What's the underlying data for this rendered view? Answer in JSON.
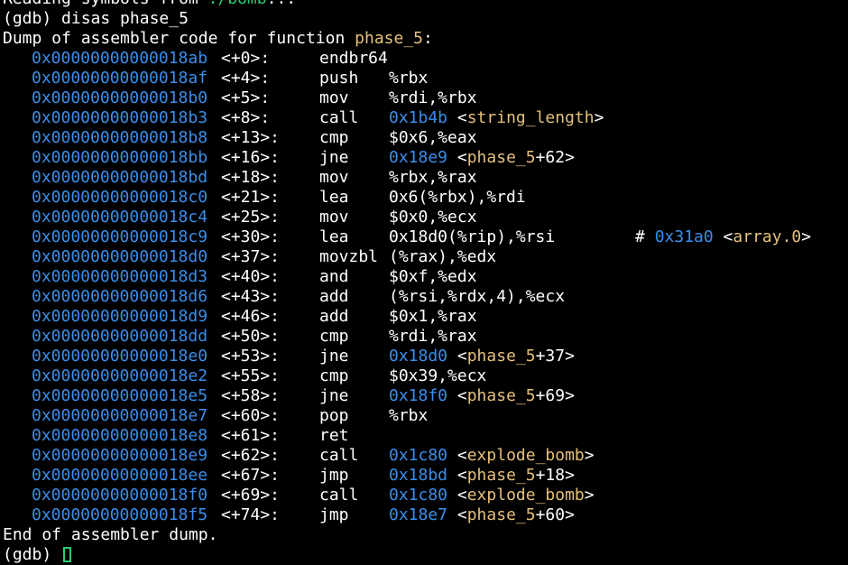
{
  "terminal": {
    "reading_line": {
      "text": "Reading symbols from ",
      "path": "./bomb",
      "suffix": "..."
    },
    "prompt": "(gdb) ",
    "command": "disas phase_5",
    "dump_header": {
      "prefix": "Dump of assembler code for function ",
      "function": "phase_5",
      "suffix": ":"
    },
    "instructions": [
      {
        "addr": "0x00000000000018ab",
        "off": "<+0>:",
        "mn": "endbr64",
        "ops": []
      },
      {
        "addr": "0x00000000000018af",
        "off": "<+4>:",
        "mn": "push",
        "ops": [
          {
            "t": "%rbx",
            "c": "w"
          }
        ]
      },
      {
        "addr": "0x00000000000018b0",
        "off": "<+5>:",
        "mn": "mov",
        "ops": [
          {
            "t": "%rdi,%rbx",
            "c": "w"
          }
        ]
      },
      {
        "addr": "0x00000000000018b3",
        "off": "<+8>:",
        "mn": "call",
        "ops": [
          {
            "t": "0x1b4b",
            "c": "b"
          },
          {
            "t": " <",
            "c": "w"
          },
          {
            "t": "string_length",
            "c": "y"
          },
          {
            "t": ">",
            "c": "w"
          }
        ]
      },
      {
        "addr": "0x00000000000018b8",
        "off": "<+13>:",
        "mn": "cmp",
        "ops": [
          {
            "t": "$0x6,%eax",
            "c": "w"
          }
        ]
      },
      {
        "addr": "0x00000000000018bb",
        "off": "<+16>:",
        "mn": "jne",
        "ops": [
          {
            "t": "0x18e9",
            "c": "b"
          },
          {
            "t": " <",
            "c": "w"
          },
          {
            "t": "phase_5",
            "c": "y"
          },
          {
            "t": "+62>",
            "c": "w"
          }
        ]
      },
      {
        "addr": "0x00000000000018bd",
        "off": "<+18>:",
        "mn": "mov",
        "ops": [
          {
            "t": "%rbx,%rax",
            "c": "w"
          }
        ]
      },
      {
        "addr": "0x00000000000018c0",
        "off": "<+21>:",
        "mn": "lea",
        "ops": [
          {
            "t": "0x6(%rbx),%rdi",
            "c": "w"
          }
        ]
      },
      {
        "addr": "0x00000000000018c4",
        "off": "<+25>:",
        "mn": "mov",
        "ops": [
          {
            "t": "$0x0,%ecx",
            "c": "w"
          }
        ]
      },
      {
        "addr": "0x00000000000018c9",
        "off": "<+30>:",
        "mn": "lea",
        "ops": [
          {
            "t": "0x18d0(%rip),%rsi",
            "c": "w"
          }
        ],
        "comment": [
          {
            "t": "# ",
            "c": "w"
          },
          {
            "t": "0x31a0",
            "c": "b"
          },
          {
            "t": " <",
            "c": "w"
          },
          {
            "t": "array.0",
            "c": "y"
          },
          {
            "t": ">",
            "c": "w"
          }
        ]
      },
      {
        "addr": "0x00000000000018d0",
        "off": "<+37>:",
        "mn": "movzbl",
        "ops": [
          {
            "t": "(%rax),%edx",
            "c": "w"
          }
        ]
      },
      {
        "addr": "0x00000000000018d3",
        "off": "<+40>:",
        "mn": "and",
        "ops": [
          {
            "t": "$0xf,%edx",
            "c": "w"
          }
        ]
      },
      {
        "addr": "0x00000000000018d6",
        "off": "<+43>:",
        "mn": "add",
        "ops": [
          {
            "t": "(%rsi,%rdx,4),%ecx",
            "c": "w"
          }
        ]
      },
      {
        "addr": "0x00000000000018d9",
        "off": "<+46>:",
        "mn": "add",
        "ops": [
          {
            "t": "$0x1,%rax",
            "c": "w"
          }
        ]
      },
      {
        "addr": "0x00000000000018dd",
        "off": "<+50>:",
        "mn": "cmp",
        "ops": [
          {
            "t": "%rdi,%rax",
            "c": "w"
          }
        ]
      },
      {
        "addr": "0x00000000000018e0",
        "off": "<+53>:",
        "mn": "jne",
        "ops": [
          {
            "t": "0x18d0",
            "c": "b"
          },
          {
            "t": " <",
            "c": "w"
          },
          {
            "t": "phase_5",
            "c": "y"
          },
          {
            "t": "+37>",
            "c": "w"
          }
        ]
      },
      {
        "addr": "0x00000000000018e2",
        "off": "<+55>:",
        "mn": "cmp",
        "ops": [
          {
            "t": "$0x39,%ecx",
            "c": "w"
          }
        ]
      },
      {
        "addr": "0x00000000000018e5",
        "off": "<+58>:",
        "mn": "jne",
        "ops": [
          {
            "t": "0x18f0",
            "c": "b"
          },
          {
            "t": " <",
            "c": "w"
          },
          {
            "t": "phase_5",
            "c": "y"
          },
          {
            "t": "+69>",
            "c": "w"
          }
        ]
      },
      {
        "addr": "0x00000000000018e7",
        "off": "<+60>:",
        "mn": "pop",
        "ops": [
          {
            "t": "%rbx",
            "c": "w"
          }
        ]
      },
      {
        "addr": "0x00000000000018e8",
        "off": "<+61>:",
        "mn": "ret",
        "ops": []
      },
      {
        "addr": "0x00000000000018e9",
        "off": "<+62>:",
        "mn": "call",
        "ops": [
          {
            "t": "0x1c80",
            "c": "b"
          },
          {
            "t": " <",
            "c": "w"
          },
          {
            "t": "explode_bomb",
            "c": "y"
          },
          {
            "t": ">",
            "c": "w"
          }
        ]
      },
      {
        "addr": "0x00000000000018ee",
        "off": "<+67>:",
        "mn": "jmp",
        "ops": [
          {
            "t": "0x18bd",
            "c": "b"
          },
          {
            "t": " <",
            "c": "w"
          },
          {
            "t": "phase_5",
            "c": "y"
          },
          {
            "t": "+18>",
            "c": "w"
          }
        ]
      },
      {
        "addr": "0x00000000000018f0",
        "off": "<+69>:",
        "mn": "call",
        "ops": [
          {
            "t": "0x1c80",
            "c": "b"
          },
          {
            "t": " <",
            "c": "w"
          },
          {
            "t": "explode_bomb",
            "c": "y"
          },
          {
            "t": ">",
            "c": "w"
          }
        ]
      },
      {
        "addr": "0x00000000000018f5",
        "off": "<+74>:",
        "mn": "jmp",
        "ops": [
          {
            "t": "0x18e7",
            "c": "b"
          },
          {
            "t": " <",
            "c": "w"
          },
          {
            "t": "phase_5",
            "c": "y"
          },
          {
            "t": "+60>",
            "c": "w"
          }
        ]
      }
    ],
    "dump_footer": "End of assembler dump.",
    "final_prompt": "(gdb) "
  },
  "colors": {
    "background": "#000000",
    "text": "#ffffff",
    "address": "#3b8eea",
    "symbol": "#e5c07b",
    "cursor": "#2ecc71"
  }
}
